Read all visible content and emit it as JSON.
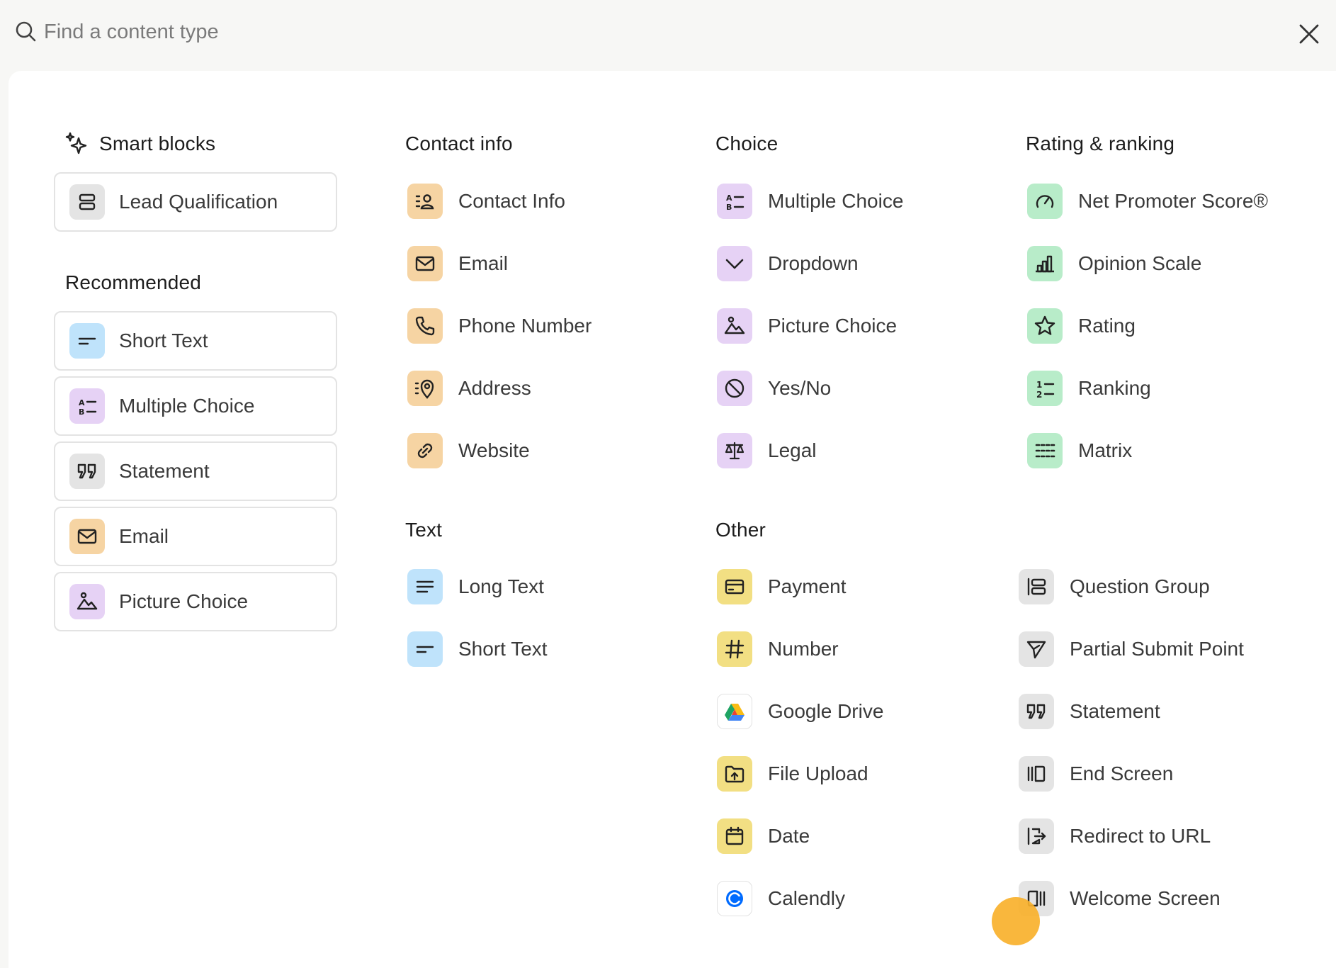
{
  "search": {
    "placeholder": "Find a content type"
  },
  "sections": {
    "smart_blocks": "Smart blocks",
    "recommended": "Recommended",
    "contact_info": "Contact info",
    "text": "Text",
    "choice": "Choice",
    "other": "Other",
    "rating": "Rating & ranking"
  },
  "smart_blocks": [
    {
      "label": "Lead Qualification",
      "icon": "form-stack-icon",
      "color": "#e4e4e4"
    }
  ],
  "recommended": [
    {
      "label": "Short Text",
      "icon": "short-text-icon",
      "color": "#bfe3fb"
    },
    {
      "label": "Multiple Choice",
      "icon": "multiple-choice-icon",
      "color": "#e6d2f5"
    },
    {
      "label": "Statement",
      "icon": "quote-icon",
      "color": "#e4e4e4"
    },
    {
      "label": "Email",
      "icon": "envelope-icon",
      "color": "#f6d4a3"
    },
    {
      "label": "Picture Choice",
      "icon": "picture-icon",
      "color": "#e6d2f5"
    }
  ],
  "contact_info": [
    {
      "label": "Contact Info",
      "icon": "contact-card-icon"
    },
    {
      "label": "Email",
      "icon": "envelope-icon"
    },
    {
      "label": "Phone Number",
      "icon": "phone-icon"
    },
    {
      "label": "Address",
      "icon": "map-pin-icon"
    },
    {
      "label": "Website",
      "icon": "link-icon"
    }
  ],
  "text": [
    {
      "label": "Long Text",
      "icon": "long-text-icon"
    },
    {
      "label": "Short Text",
      "icon": "short-text-icon"
    }
  ],
  "choice": [
    {
      "label": "Multiple Choice",
      "icon": "multiple-choice-icon"
    },
    {
      "label": "Dropdown",
      "icon": "chevron-down-icon"
    },
    {
      "label": "Picture Choice",
      "icon": "picture-icon"
    },
    {
      "label": "Yes/No",
      "icon": "yes-no-icon"
    },
    {
      "label": "Legal",
      "icon": "scales-icon"
    }
  ],
  "rating": [
    {
      "label": "Net Promoter Score®",
      "icon": "gauge-icon"
    },
    {
      "label": "Opinion Scale",
      "icon": "bar-scale-icon"
    },
    {
      "label": "Rating",
      "icon": "star-icon"
    },
    {
      "label": "Ranking",
      "icon": "ranking-icon"
    },
    {
      "label": "Matrix",
      "icon": "matrix-icon"
    }
  ],
  "other_left": [
    {
      "label": "Payment",
      "icon": "credit-card-icon"
    },
    {
      "label": "Number",
      "icon": "hash-icon"
    },
    {
      "label": "Google Drive",
      "icon": "google-drive-icon"
    },
    {
      "label": "File Upload",
      "icon": "folder-upload-icon"
    },
    {
      "label": "Date",
      "icon": "calendar-icon"
    },
    {
      "label": "Calendly",
      "icon": "calendly-icon"
    }
  ],
  "other_right": [
    {
      "label": "Question Group",
      "icon": "question-group-icon"
    },
    {
      "label": "Partial Submit Point",
      "icon": "send-icon"
    },
    {
      "label": "Statement",
      "icon": "quote-icon"
    },
    {
      "label": "End Screen",
      "icon": "end-screen-icon"
    },
    {
      "label": "Redirect to URL",
      "icon": "redirect-icon"
    },
    {
      "label": "Welcome Screen",
      "icon": "welcome-screen-icon"
    }
  ]
}
